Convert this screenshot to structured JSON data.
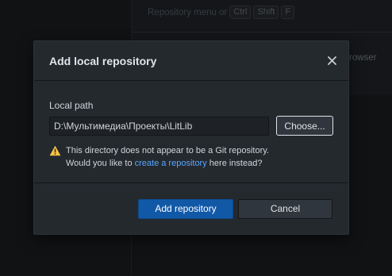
{
  "background": {
    "hint_text": "Repository menu or",
    "shortcut_keys": [
      "Ctrl",
      "Shift",
      "F"
    ],
    "browser_label": "rowser"
  },
  "dialog": {
    "title": "Add local repository",
    "close_icon": "close-icon",
    "local_path_label": "Local path",
    "local_path_value": "D:\\Мультимедиа\\Проекты\\LitLib",
    "choose_label": "Choose...",
    "warning_icon": "warning-triangle-icon",
    "warning_line1": "This directory does not appear to be a Git repository.",
    "warning_line2_prefix": "Would you like to ",
    "warning_link": "create a repository",
    "warning_line2_suffix": " here instead?",
    "add_button_label": "Add repository",
    "cancel_button_label": "Cancel"
  },
  "colors": {
    "accent_primary": "#1158a7",
    "link": "#58a6ff",
    "warning": "#f6c343"
  }
}
